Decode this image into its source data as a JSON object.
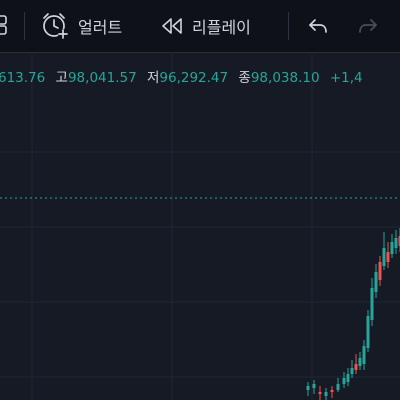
{
  "toolbar": {
    "alert_label": "얼러트",
    "replay_label": "리플레이",
    "icons": {
      "partial": "square-icon",
      "alert": "alarm-clock-plus-icon",
      "replay": "rewind-icon",
      "undo": "undo-arrow-icon",
      "redo": "redo-arrow-icon"
    }
  },
  "ohlc": {
    "open_partial": "613.76",
    "high_label": "고",
    "high_value": "98,041.57",
    "low_label": "저",
    "low_value": "96,292.47",
    "close_label": "종",
    "close_value": "98,038.10",
    "change_partial": "+1,4"
  },
  "colors": {
    "background": "#161a25",
    "toolbar": "#0f1119",
    "up": "#26a69a",
    "down": "#ef5350",
    "text": "#d1d4dc",
    "grid": "#252a36"
  },
  "chart_data": {
    "type": "candlestick",
    "price_line": "dotted horizontal line at current price",
    "grid": true,
    "candles_visible": "right edge only, steep upward trend"
  }
}
